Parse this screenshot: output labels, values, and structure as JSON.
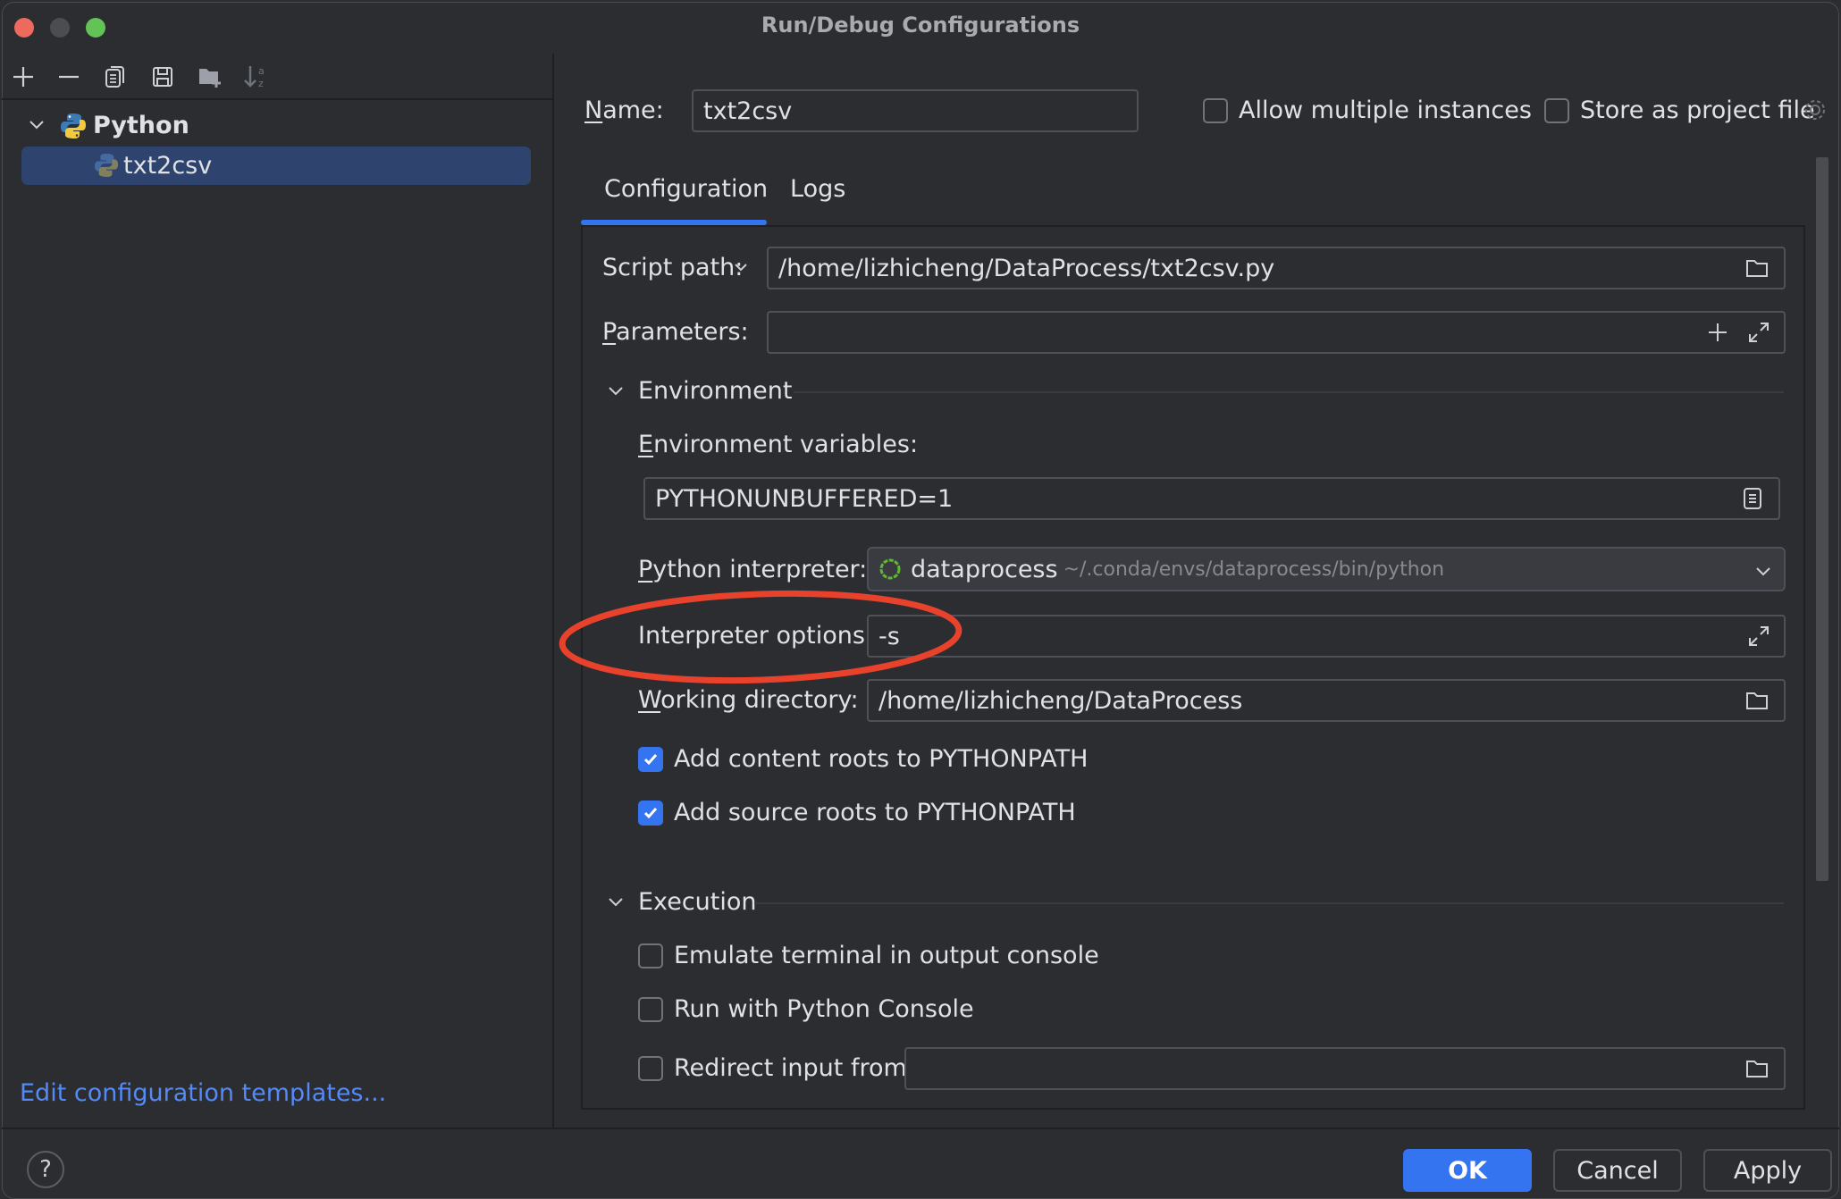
{
  "window": {
    "title": "Run/Debug Configurations",
    "traffic_lights": {
      "close": "#ec6a5e",
      "minimize": "#4c4d50",
      "maximize": "#61c454"
    }
  },
  "toolbar": {
    "icons": [
      "add-icon",
      "remove-icon",
      "copy-icon",
      "save-icon",
      "new-folder-icon",
      "sort-alpha-icon"
    ]
  },
  "tree": {
    "group_label": "Python",
    "items": [
      {
        "label": "txt2csv",
        "selected": true
      }
    ]
  },
  "sidebar_link": "Edit configuration templates...",
  "header": {
    "name_label": "Name:",
    "name_mnemonic": "N",
    "name_rest": "ame:",
    "name_value": "txt2csv",
    "allow_multiple_label": "Allow multiple instances",
    "allow_multiple_checked": false,
    "store_project_label": "Store as project file",
    "store_project_checked": false
  },
  "tabs": [
    {
      "label": "Configuration",
      "active": true
    },
    {
      "label": "Logs",
      "active": false
    }
  ],
  "form": {
    "script_path_label": "Script path:",
    "script_path_value": "/home/lizhicheng/DataProcess/txt2csv.py",
    "parameters_mnemonic": "P",
    "parameters_rest": "arameters:",
    "parameters_value": "",
    "environment_section": "Environment",
    "env_vars_mnemonic": "E",
    "env_vars_rest": "nvironment variables:",
    "env_vars_value": "PYTHONUNBUFFERED=1",
    "interpreter_mnemonic": "P",
    "interpreter_rest": "ython interpreter:",
    "interpreter_name": "dataprocess",
    "interpreter_path": "~/.conda/envs/dataprocess/bin/python",
    "interp_options_label": "Interpreter options:",
    "interp_options_value": "-s",
    "working_dir_mnemonic": "W",
    "working_dir_rest": "orking directory:",
    "working_dir_value": "/home/lizhicheng/DataProcess",
    "add_content_roots_label": "Add content roots to PYTHONPATH",
    "add_content_roots_checked": true,
    "add_source_roots_label": "Add source roots to PYTHONPATH",
    "add_source_roots_checked": true,
    "execution_section": "Execution",
    "emulate_terminal_label": "Emulate terminal in output console",
    "emulate_terminal_checked": false,
    "python_console_label": "Run with Python Console",
    "python_console_checked": false,
    "redirect_input_label": "Redirect input from:",
    "redirect_input_checked": false,
    "redirect_input_value": ""
  },
  "annotation": {
    "shape": "ellipse",
    "color": "#e8412c",
    "target": "Interpreter options"
  },
  "footer": {
    "help_label": "?",
    "ok_label": "OK",
    "cancel_label": "Cancel",
    "apply_label": "Apply"
  },
  "colors": {
    "accent": "#3574f0",
    "link": "#548af7",
    "selection": "#2e436e"
  }
}
